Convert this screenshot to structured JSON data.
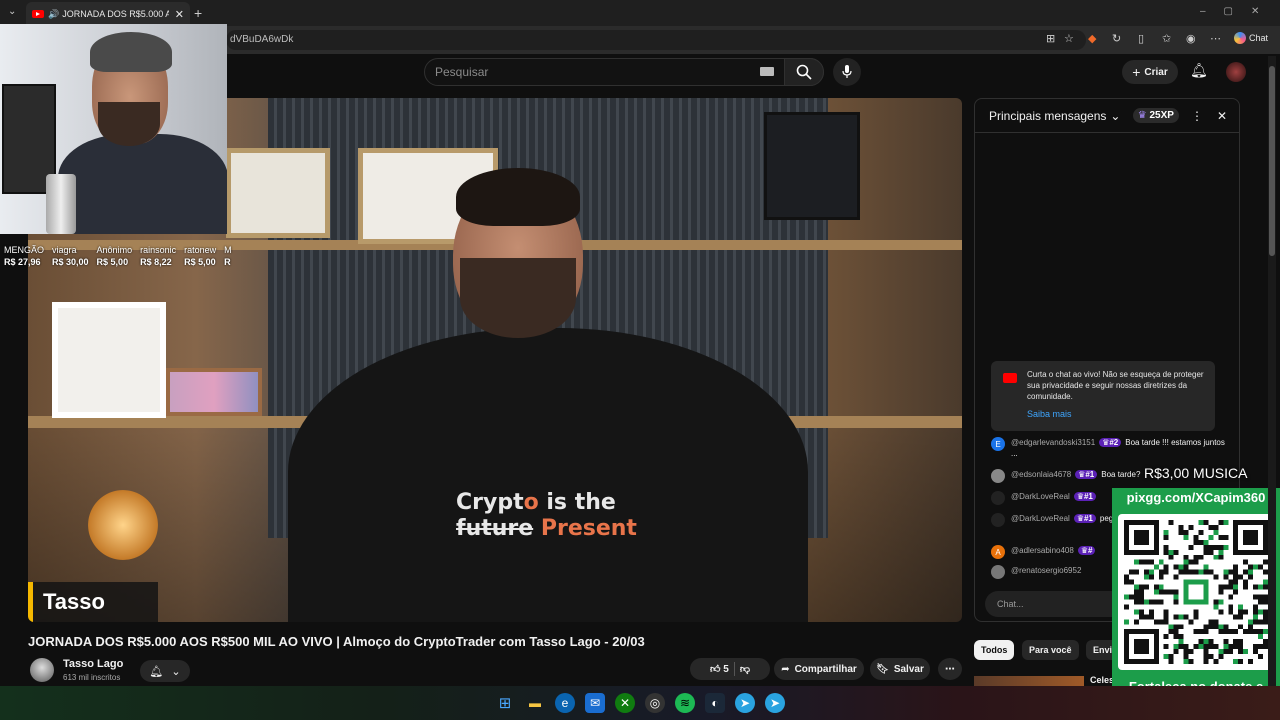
{
  "browser": {
    "tab_title": "JORNADA DOS R$5.000 AOS R$500 MIL AO VIVO",
    "url_fragment": "dVBuDA6wDk",
    "chat_button": "Chat"
  },
  "header": {
    "search_placeholder": "Pesquisar",
    "create_label": "Criar"
  },
  "video": {
    "shirt_line1a": "Crypt",
    "shirt_o": "o",
    "shirt_line1b": " is the",
    "shirt_line2a": "future",
    "shirt_line2b": " Present",
    "lower_third": "Tasso Lago",
    "donors": [
      {
        "name": "MENGÃO",
        "amount": "R$ 27,96"
      },
      {
        "name": "viagra",
        "amount": "R$ 30,00"
      },
      {
        "name": "Anônimo",
        "amount": "R$ 5,00"
      },
      {
        "name": "rainsonic",
        "amount": "R$ 8,22"
      },
      {
        "name": "ratonew",
        "amount": "R$ 5,00"
      },
      {
        "name": "M",
        "amount": "R"
      }
    ]
  },
  "info": {
    "title": "JORNADA DOS R$5.000 AOS R$500 MIL AO VIVO | Almoço do CryptoTrader com Tasso Lago - 20/03",
    "channel": "Tasso Lago",
    "subscribers": "613 mil inscritos",
    "likes": "5",
    "share": "Compartilhar",
    "save": "Salvar"
  },
  "chat": {
    "header": "Principais mensagens",
    "xp": "25XP",
    "notice_text": "Curta o chat ao vivo! Não se esqueça de proteger sua privacidade e seguir nossas diretrizes da comunidade.",
    "notice_link": "Saiba mais",
    "messages": [
      {
        "initial": "E",
        "user": "@edgarlevandoski3151",
        "badge": "#2",
        "text": "Boa tarde !!! estamos juntos ..."
      },
      {
        "initial": "",
        "user": "@edsonlaia4678",
        "badge": "#1",
        "text": "Boa tarde?"
      },
      {
        "initial": "",
        "user": "@DarkLoveReal",
        "badge": "#1",
        "text": ""
      },
      {
        "initial": "",
        "user": "@DarkLoveReal",
        "badge": "#1",
        "text": "pegou, mas ta bom, mao"
      },
      {
        "initial": "A",
        "user": "@adlersabino408",
        "badge": "#",
        "text": ""
      },
      {
        "initial": "",
        "user": "@renatosergio6952",
        "badge": "",
        "text": ""
      }
    ],
    "input_placeholder": "Chat...",
    "chips": [
      "Todos",
      "Para você",
      "Envia"
    ],
    "bottom_label": "Celes"
  },
  "overlay": {
    "music": "R$3,00 MUSICA",
    "pix_url": "pixgg.com/XCapim360",
    "caption": "Fortaleça no donate e envie sua mensagem!"
  },
  "colors": {
    "youtube_red": "#ff0000",
    "accent_purple": "#5b21b6",
    "qr_green": "#1c9d4a",
    "link_blue": "#3ea6ff"
  }
}
